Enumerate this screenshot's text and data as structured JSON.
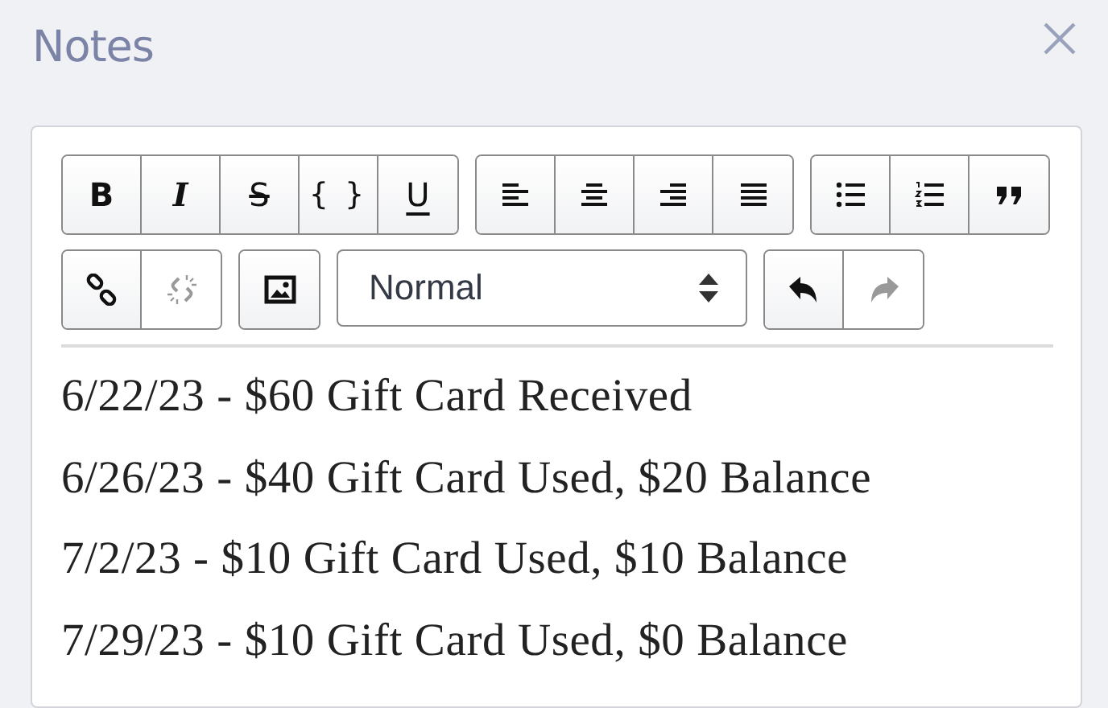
{
  "dialog": {
    "title": "Notes"
  },
  "toolbar_rows": [
    [
      {
        "kind": "group",
        "buttons": [
          {
            "kind": "bold",
            "label": "B",
            "disabled": false
          },
          {
            "kind": "italic",
            "label": "I",
            "disabled": false
          },
          {
            "kind": "strike",
            "label": "S",
            "disabled": false
          },
          {
            "kind": "code",
            "label": "{ }",
            "disabled": false
          },
          {
            "kind": "underline",
            "label": "U",
            "disabled": false
          }
        ]
      },
      {
        "kind": "group",
        "buttons": [
          {
            "kind": "align-left",
            "disabled": false
          },
          {
            "kind": "align-center",
            "disabled": false
          },
          {
            "kind": "align-right",
            "disabled": false
          },
          {
            "kind": "justify",
            "disabled": false
          }
        ]
      },
      {
        "kind": "group",
        "buttons": [
          {
            "kind": "bullet-list",
            "disabled": false
          },
          {
            "kind": "numbered-list",
            "disabled": false
          },
          {
            "kind": "quote",
            "disabled": false
          }
        ]
      }
    ],
    [
      {
        "kind": "group",
        "buttons": [
          {
            "kind": "link",
            "disabled": false
          },
          {
            "kind": "unlink",
            "disabled": true
          }
        ]
      },
      {
        "kind": "group",
        "buttons": [
          {
            "kind": "image",
            "disabled": false
          }
        ]
      },
      {
        "kind": "select",
        "value": "Normal"
      },
      {
        "kind": "group",
        "buttons": [
          {
            "kind": "undo",
            "disabled": false
          },
          {
            "kind": "redo",
            "disabled": true
          }
        ]
      }
    ]
  ],
  "notes": [
    "6/22/23 - $60 Gift Card Received",
    "6/26/23 - $40 Gift Card Used, $20 Balance",
    "7/2/23 - $10 Gift Card Used, $10 Balance",
    "7/29/23 - $10 Gift Card Used, $0 Balance"
  ]
}
